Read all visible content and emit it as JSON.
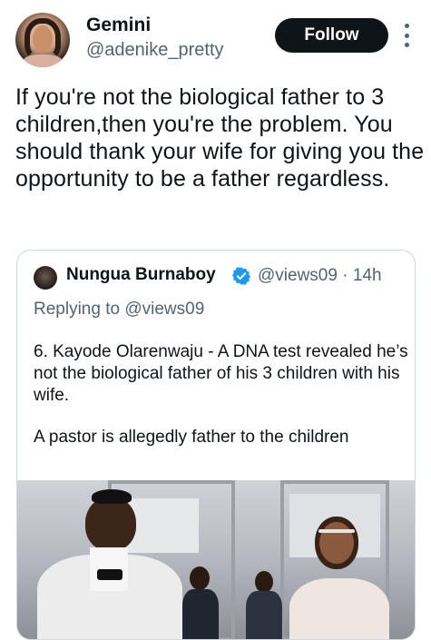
{
  "author": {
    "display_name": "Gemini",
    "handle": "@adenike_pretty",
    "avatar_icon": "profile-avatar"
  },
  "follow_label": "Follow",
  "tweet_text": "If you're not the biological father to 3 children,then you're the problem. You should thank your wife for giving you the opportunity to be a father regardless.",
  "quoted": {
    "display_name": "Nungua Burnaboy",
    "verified_icon": "verified-badge-icon",
    "handle_time": "@views09 · 14h",
    "replying_prefix": "Replying to ",
    "replying_handle": "@views09",
    "paragraph_1": "6. Kayode Olarenwaju  - A DNA test revealed he’s not the biological father of his 3 children with his wife.",
    "paragraph_2": "A pastor is allegedly father to the children"
  },
  "colors": {
    "text": "#0f1419",
    "secondary": "#536471",
    "border": "#cfd9de",
    "verified": "#1d9bf0",
    "follow_bg": "#0f1419"
  }
}
